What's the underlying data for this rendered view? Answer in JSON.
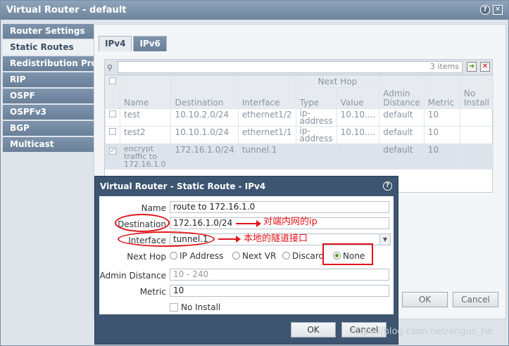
{
  "outer_window": {
    "title": "Virtual Router - default",
    "help_glyph": "?",
    "close_glyph": "✕",
    "ok_label": "OK",
    "cancel_label": "Cancel"
  },
  "sidebar": {
    "items": [
      {
        "label": "Router Settings",
        "active": false
      },
      {
        "label": "Static Routes",
        "active": true
      },
      {
        "label": "Redistribution Profile",
        "active": false
      },
      {
        "label": "RIP",
        "active": false
      },
      {
        "label": "OSPF",
        "active": false
      },
      {
        "label": "OSPFv3",
        "active": false
      },
      {
        "label": "BGP",
        "active": false
      },
      {
        "label": "Multicast",
        "active": false
      }
    ]
  },
  "tabs": [
    {
      "label": "IPv4",
      "active": true
    },
    {
      "label": "IPv6",
      "active": false
    }
  ],
  "grid": {
    "items_count": "3 items",
    "group_header": "Next Hop",
    "columns": [
      "Name",
      "Destination",
      "Interface",
      "Type",
      "Value",
      "Admin Distance",
      "Metric",
      "No Install"
    ],
    "rows": [
      {
        "name": "test",
        "destination": "10.10.2.0/24",
        "interface": "ethernet1/2",
        "type": "ip-address",
        "value": "10.10....",
        "admin_distance": "default",
        "metric": "10",
        "checked": false,
        "selected": false
      },
      {
        "name": "test2",
        "destination": "10.10.1.0/24",
        "interface": "ethernet1/1",
        "type": "ip-address",
        "value": "10.10....",
        "admin_distance": "default",
        "metric": "10",
        "checked": false,
        "selected": false
      },
      {
        "name": "encrypt traffic to 172.16.1.0",
        "destination": "172.16.1.0/24",
        "interface": "tunnel.1",
        "type": "",
        "value": "",
        "admin_distance": "default",
        "metric": "10",
        "checked": true,
        "selected": true
      }
    ]
  },
  "modal": {
    "title": "Virtual Router - Static Route - IPv4",
    "help_glyph": "?",
    "name_label": "Name",
    "name_value": "route to 172.16.1.0",
    "destination_label": "Destination",
    "destination_value": "172.16.1.0/24",
    "interface_label": "Interface",
    "interface_value": "tunnel.1",
    "next_hop_label": "Next Hop",
    "next_hop_options": [
      "IP Address",
      "Next VR",
      "Discard",
      "None"
    ],
    "next_hop_selected": "None",
    "admin_distance_label": "Admin Distance",
    "admin_distance_placeholder": "10 - 240",
    "metric_label": "Metric",
    "metric_value": "10",
    "no_install_label": "No Install",
    "ok_label": "OK",
    "cancel_label": "Cancel"
  },
  "annotations": {
    "destination_note": "对端内网的ip",
    "interface_note": "本地的隧道接口",
    "color": "#e0151b"
  },
  "watermark": "https://blog.csdn.net/angus_he"
}
